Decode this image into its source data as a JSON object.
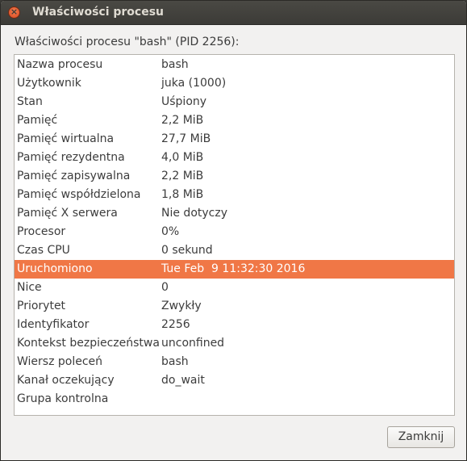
{
  "window": {
    "title": "Właściwości procesu",
    "close_symbol": "×"
  },
  "heading": "Właściwości procesu \"bash\" (PID 2256):",
  "rows": [
    {
      "key": "Nazwa procesu",
      "value": "bash"
    },
    {
      "key": "Użytkownik",
      "value": "juka (1000)"
    },
    {
      "key": "Stan",
      "value": "Uśpiony"
    },
    {
      "key": "Pamięć",
      "value": "2,2 MiB"
    },
    {
      "key": "Pamięć wirtualna",
      "value": "27,7 MiB"
    },
    {
      "key": "Pamięć rezydentna",
      "value": "4,0 MiB"
    },
    {
      "key": "Pamięć zapisywalna",
      "value": "2,2 MiB"
    },
    {
      "key": "Pamięć współdzielona",
      "value": "1,8 MiB"
    },
    {
      "key": "Pamięć X serwera",
      "value": "Nie dotyczy"
    },
    {
      "key": "Procesor",
      "value": "0%"
    },
    {
      "key": "Czas CPU",
      "value": "0 sekund"
    },
    {
      "key": "Uruchomiono",
      "value": "Tue Feb  9 11:32:30 2016",
      "selected": true
    },
    {
      "key": "Nice",
      "value": "0"
    },
    {
      "key": "Priorytet",
      "value": "Zwykły"
    },
    {
      "key": "Identyfikator",
      "value": "2256"
    },
    {
      "key": "Kontekst bezpieczeństwa",
      "value": "unconfined"
    },
    {
      "key": "Wiersz poleceń",
      "value": "bash"
    },
    {
      "key": "Kanał oczekujący",
      "value": "do_wait"
    },
    {
      "key": "Grupa kontrolna",
      "value": ""
    }
  ],
  "buttons": {
    "close_label": "Zamknij"
  },
  "colors": {
    "selection": "#f07746",
    "titlebar": "#3c3b37"
  }
}
